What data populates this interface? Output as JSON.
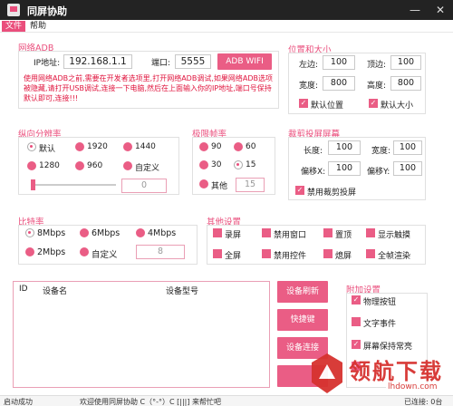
{
  "app": {
    "title": "同屏协助"
  },
  "window_controls": {
    "minimize": "—",
    "close": "✕"
  },
  "menu": {
    "items": [
      "文件",
      "帮助"
    ]
  },
  "network_adb": {
    "title": "网络ADB",
    "ip_label": "IP地址:",
    "ip_value": "192.168.1.1",
    "port_label": "端口:",
    "port_value": "5555",
    "button": "ADB WIFI",
    "notice": "使用网络ADB之前,需要在开发者选项里,打开网络ADB调试,如果网络ADB选项被隐藏,请打开USB调试,连接一下电脑,然后在上面输入你的IP地址,端口号保持默认即可,连接!!!"
  },
  "position_size": {
    "title": "位置和大小",
    "left_label": "左边:",
    "left_value": "100",
    "top_label": "顶边:",
    "top_value": "100",
    "width_label": "宽度:",
    "width_value": "800",
    "height_label": "高度:",
    "height_value": "800",
    "default_pos": "默认位置",
    "default_size": "默认大小"
  },
  "resolution": {
    "title": "纵向分辨率",
    "options": [
      "默认",
      "1920",
      "1440",
      "1280",
      "960",
      "自定义"
    ],
    "selected": "默认",
    "custom_value": "0"
  },
  "fps": {
    "title": "极限帧率",
    "options": [
      "90",
      "60",
      "30",
      "15",
      "其他"
    ],
    "selected": "15",
    "other_value": "15"
  },
  "crop": {
    "title": "裁剪投屏屏幕",
    "len_label": "长度:",
    "len_value": "100",
    "width_label": "宽度:",
    "width_value": "100",
    "offx_label": "偏移X:",
    "offx_value": "100",
    "offy_label": "偏移Y:",
    "offy_value": "100",
    "disable": "禁用裁剪投屏"
  },
  "bitrate": {
    "title": "比特率",
    "options": [
      "8Mbps",
      "6Mbps",
      "4Mbps",
      "2Mbps",
      "自定义"
    ],
    "selected": "8Mbps",
    "custom_value": "8"
  },
  "other": {
    "title": "其他设置",
    "options": [
      "录屏",
      "禁用窗口",
      "置顶",
      "显示触摸",
      "全屏",
      "禁用控件",
      "熄屏",
      "全帧渲染"
    ]
  },
  "devices": {
    "col_id": "ID",
    "col_name": "设备名",
    "col_model": "设备型号"
  },
  "actions": {
    "refresh": "设备刷新",
    "shortcuts": "快捷键",
    "connect": "设备连接"
  },
  "extra": {
    "title": "附加设置",
    "options": [
      "物理按钮",
      "文字事件",
      "屏幕保持常亮"
    ]
  },
  "status": {
    "left": "启动成功",
    "center": "欢迎使用同屏协助 C（°-°）C [|||] 来帮忙吧",
    "right": "已连接: 0台"
  },
  "watermark": {
    "text": "领航下载",
    "site": "lhdown.com"
  },
  "colors": {
    "accent": "#ea4e7c",
    "titlebar": "#232323",
    "warning": "#e0133c"
  }
}
